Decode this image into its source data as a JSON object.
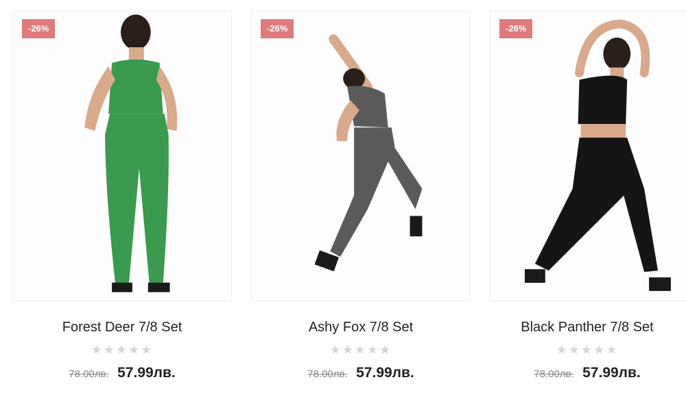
{
  "products": [
    {
      "badge": "-26%",
      "title": "Forest Deer 7/8 Set",
      "old_price": "78.00лв.",
      "new_price": "57.99лв.",
      "rating_stars": "★★★★★",
      "color": "#3a9a4e"
    },
    {
      "badge": "-26%",
      "title": "Ashy Fox 7/8 Set",
      "old_price": "78.00лв.",
      "new_price": "57.99лв.",
      "rating_stars": "★★★★★",
      "color": "#5a5a5a"
    },
    {
      "badge": "-26%",
      "title": "Black Panther 7/8 Set",
      "old_price": "78.00лв.",
      "new_price": "57.99лв.",
      "rating_stars": "★★★★★",
      "color": "#151515"
    }
  ]
}
